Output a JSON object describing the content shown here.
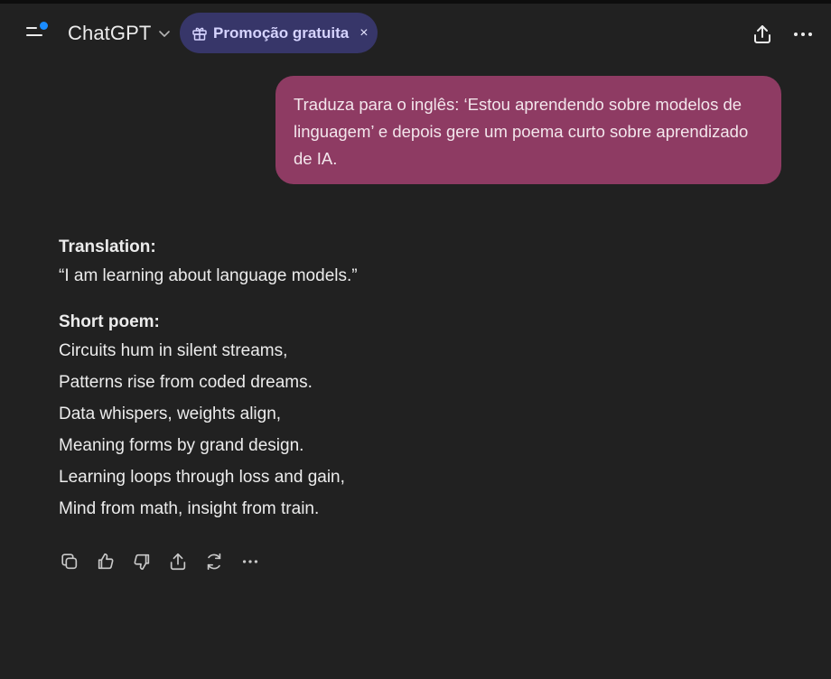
{
  "header": {
    "model_name": "ChatGPT",
    "promo_label": "Promoção gratuita",
    "promo_close": "×"
  },
  "conversation": {
    "user_message": "Traduza para o inglês: ‘Estou aprendendo sobre modelos de linguagem’ e depois gere um poema curto sobre aprendizado de IA.",
    "assistant": {
      "translation_heading": "Translation:",
      "translation_text": "“I am learning about language models.”",
      "poem_heading": "Short poem:",
      "poem_lines": [
        "Circuits hum in silent streams,",
        "Patterns rise from coded dreams.",
        "Data whispers, weights align,",
        "Meaning forms by grand design.",
        "Learning loops through loss and gain,",
        "Mind from math, insight from train."
      ]
    }
  },
  "actions": {
    "icons": [
      "copy-icon",
      "thumbs-up-icon",
      "thumbs-down-icon",
      "share-icon",
      "regenerate-icon",
      "more-icon"
    ]
  },
  "colors": {
    "background": "#212121",
    "user_bubble": "#8e3b63",
    "promo_pill": "#373669",
    "notification_dot": "#1a8cff"
  }
}
